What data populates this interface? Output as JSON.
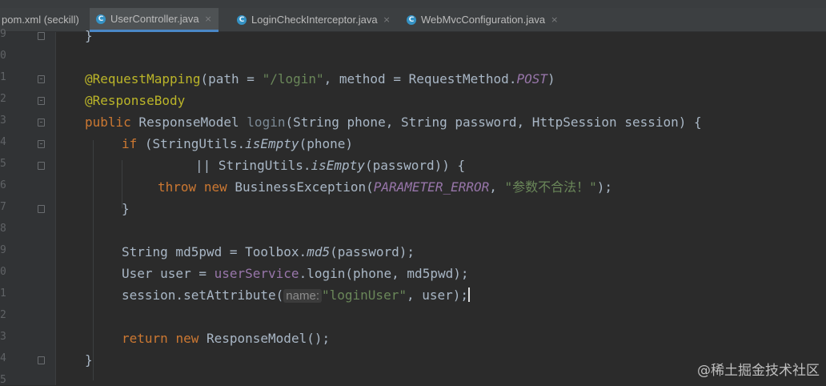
{
  "tabs": [
    {
      "label": "pom.xml (seckill)",
      "active": false,
      "icon": "none"
    },
    {
      "label": "UserController.java",
      "active": true,
      "icon": "java-class-icon"
    },
    {
      "label": "LoginCheckInterceptor.java",
      "active": false,
      "icon": "java-class-icon"
    },
    {
      "label": "WebMvcConfiguration.java",
      "active": false,
      "icon": "java-class-icon"
    }
  ],
  "close_glyph": "×",
  "class_icon_letter": "C",
  "line_numbers": [
    "9",
    "0",
    "1",
    "2",
    "3",
    "4",
    "5",
    "6",
    "7",
    "8",
    "9",
    "0",
    "1",
    "2",
    "3",
    "4",
    "5"
  ],
  "code": {
    "l0": "}",
    "l2_ann": "@RequestMapping",
    "l2_a": "(path = ",
    "l2_str": "\"/login\"",
    "l2_b": ", method = RequestMethod.",
    "l2_cst": "POST",
    "l2_c": ")",
    "l3_ann": "@ResponseBody",
    "l4_k": "public",
    "l4_a": " ResponseModel ",
    "l4_m": "login",
    "l4_b": "(String phone, String password, HttpSession session) {",
    "l5_k": "if",
    "l5_a": " (StringUtils.",
    "l5_it": "isEmpty",
    "l5_b": "(phone)",
    "l6_a": "|| StringUtils.",
    "l6_it": "isEmpty",
    "l6_b": "(password)) {",
    "l7_k1": "throw",
    "l7_k2": "new",
    "l7_a": " BusinessException(",
    "l7_cst": "PARAMETER_ERROR",
    "l7_b": ", ",
    "l7_str": "\"参数不合法！\"",
    "l7_c": ");",
    "l8": "}",
    "l10_a": "String md5pwd = Toolbox.",
    "l10_it": "md5",
    "l10_b": "(password);",
    "l11_a": "User user = ",
    "l11_fld": "userService",
    "l11_b": ".login(phone, md5pwd);",
    "l12_a": "session.setAttribute(",
    "l12_hint": "name:",
    "l12_str": "\"loginUser\"",
    "l12_b": ", user);",
    "l14_k1": "return",
    "l14_k2": "new",
    "l14_a": " ResponseModel();",
    "l15": "}"
  },
  "watermark": "@稀土掘金技术社区",
  "colors": {
    "background": "#2b2b2b",
    "keyword": "#cc7832",
    "annotation": "#bbb529",
    "string": "#6a8759",
    "constant": "#9876aa",
    "accent": "#4a88c7"
  }
}
